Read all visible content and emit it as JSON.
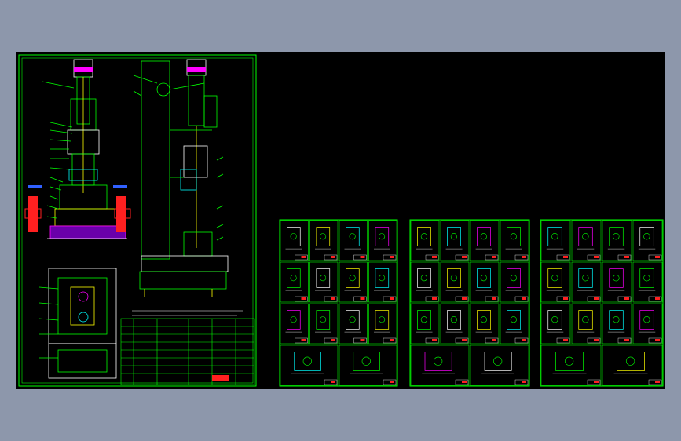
{
  "app": {
    "title": "",
    "background_color": "#8d97ab",
    "canvas_color": "#000000"
  },
  "colors": {
    "frame": "#00ff00",
    "detail": "#ffffff",
    "accent_red": "#ff2020",
    "accent_magenta": "#ff00ff",
    "accent_cyan": "#00ffff",
    "accent_yellow": "#ffff00",
    "accent_blue": "#3060ff"
  },
  "sheets": [
    {
      "name": "assembly-drawing-sheet",
      "kind": "assembly"
    },
    {
      "name": "part-drawings-sheet-1",
      "kind": "parts-grid"
    },
    {
      "name": "part-drawings-sheet-2",
      "kind": "parts-grid"
    },
    {
      "name": "part-drawings-sheet-3",
      "kind": "parts-grid"
    }
  ]
}
